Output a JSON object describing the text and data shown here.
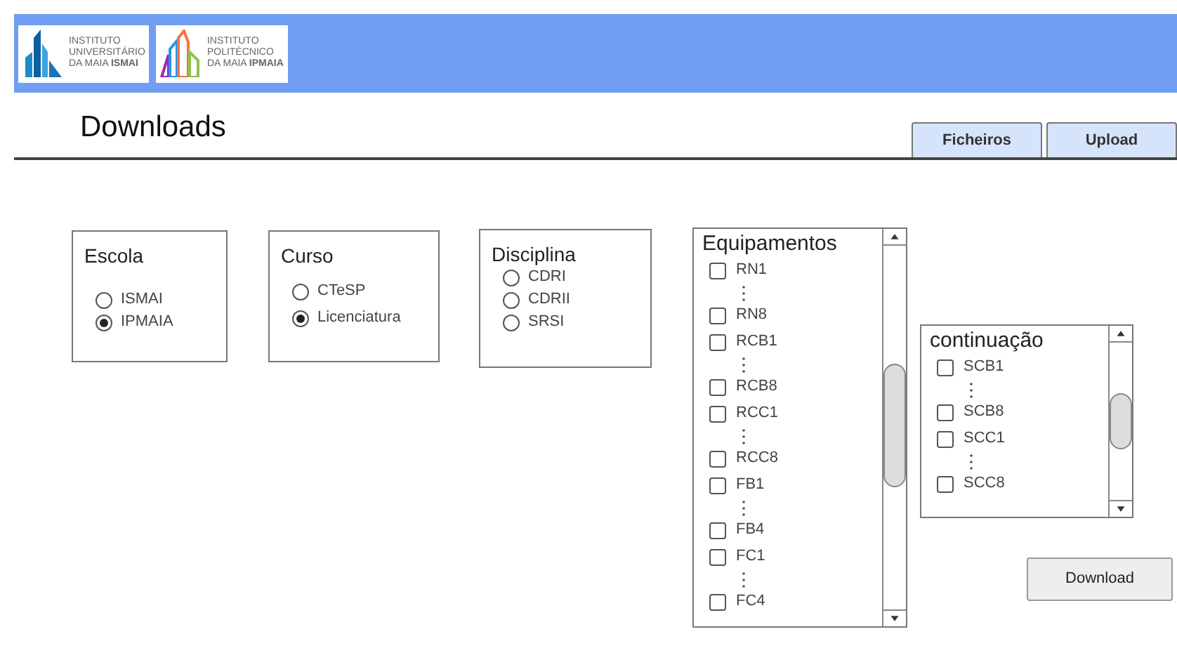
{
  "header": {
    "logos": [
      {
        "kind": "ismai",
        "lines": [
          "INSTITUTO",
          "UNIVERSITÁRIO",
          "DA MAIA **ISMAI**"
        ]
      },
      {
        "kind": "ipmaia",
        "lines": [
          "INSTITUTO",
          "POLITÉCNICO",
          "DA MAIA **IPMAIA**"
        ]
      }
    ]
  },
  "page_title": "Downloads",
  "tabs": [
    {
      "label": "Ficheiros"
    },
    {
      "label": "Upload"
    }
  ],
  "groups": [
    {
      "title": "Escola",
      "options": [
        {
          "label": "ISMAI",
          "selected": false
        },
        {
          "label": "IPMAIA",
          "selected": true
        }
      ]
    },
    {
      "title": "Curso",
      "options": [
        {
          "label": "CTeSP",
          "selected": false
        },
        {
          "label": "Licenciatura",
          "selected": true
        }
      ]
    },
    {
      "title": "Disciplina",
      "options": [
        {
          "label": "CDRI",
          "selected": false
        },
        {
          "label": "CDRII",
          "selected": false
        },
        {
          "label": "SRSI",
          "selected": false
        }
      ]
    }
  ],
  "lists": [
    {
      "title": "Equipamentos",
      "items": [
        {
          "kind": "checkbox",
          "label": "RN1",
          "checked": false
        },
        {
          "kind": "ellipsis"
        },
        {
          "kind": "checkbox",
          "label": "RN8",
          "checked": false
        },
        {
          "kind": "checkbox",
          "label": "RCB1",
          "checked": false
        },
        {
          "kind": "ellipsis"
        },
        {
          "kind": "checkbox",
          "label": "RCB8",
          "checked": false
        },
        {
          "kind": "checkbox",
          "label": "RCC1",
          "checked": false
        },
        {
          "kind": "ellipsis"
        },
        {
          "kind": "checkbox",
          "label": "RCC8",
          "checked": false
        },
        {
          "kind": "checkbox",
          "label": "FB1",
          "checked": false
        },
        {
          "kind": "ellipsis"
        },
        {
          "kind": "checkbox",
          "label": "FB4",
          "checked": false
        },
        {
          "kind": "checkbox",
          "label": "FC1",
          "checked": false
        },
        {
          "kind": "ellipsis"
        },
        {
          "kind": "checkbox",
          "label": "FC4",
          "checked": false
        }
      ]
    },
    {
      "title": "continuação",
      "items": [
        {
          "kind": "checkbox",
          "label": "SCB1",
          "checked": false
        },
        {
          "kind": "ellipsis"
        },
        {
          "kind": "checkbox",
          "label": "SCB8",
          "checked": false
        },
        {
          "kind": "checkbox",
          "label": "SCC1",
          "checked": false
        },
        {
          "kind": "ellipsis"
        },
        {
          "kind": "checkbox",
          "label": "SCC8",
          "checked": false
        }
      ]
    }
  ],
  "download_button": "Download"
}
